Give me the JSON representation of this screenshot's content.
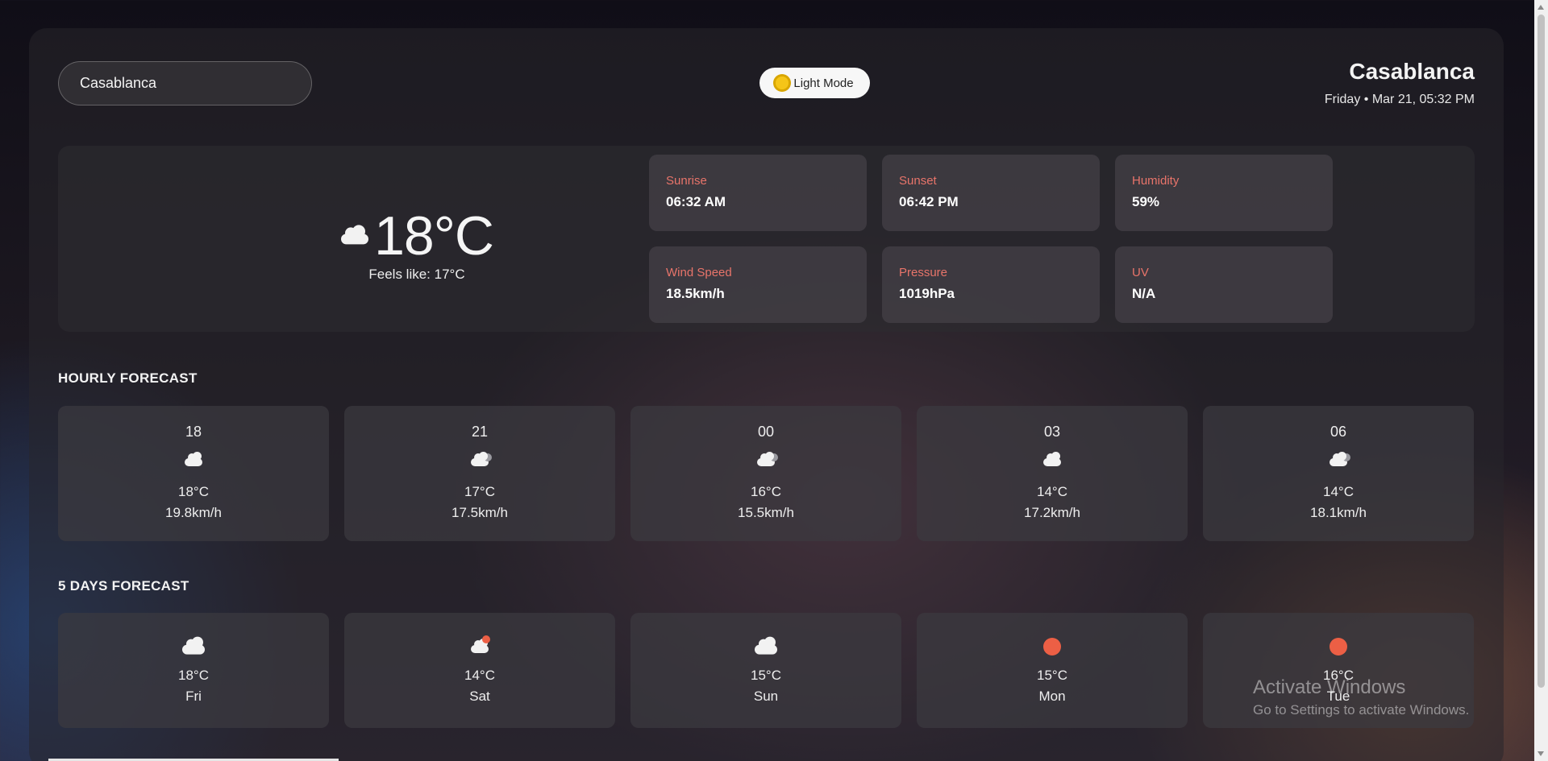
{
  "search": {
    "value": "Casablanca",
    "placeholder": ""
  },
  "theme_button": {
    "label": "Light Mode",
    "icon": "sun-icon"
  },
  "header": {
    "city": "Casablanca",
    "datetime": "Friday • Mar 21, 05:32 PM"
  },
  "current": {
    "icon": "cloud-icon",
    "temp": "18°C",
    "feels_like": "Feels like: 17°C",
    "stats": [
      {
        "label": "Sunrise",
        "value": "06:32 AM"
      },
      {
        "label": "Sunset",
        "value": "06:42 PM"
      },
      {
        "label": "Humidity",
        "value": "59%"
      },
      {
        "label": "Wind Speed",
        "value": "18.5km/h"
      },
      {
        "label": "Pressure",
        "value": "1019hPa"
      },
      {
        "label": "UV",
        "value": "N/A"
      }
    ]
  },
  "hourly": {
    "title": "HOURLY FORECAST",
    "items": [
      {
        "hour": "18",
        "icon": "cloud-icon",
        "temp": "18°C",
        "wind": "19.8km/h"
      },
      {
        "hour": "21",
        "icon": "cloud-icon",
        "temp": "17°C",
        "wind": "17.5km/h"
      },
      {
        "hour": "00",
        "icon": "cloud-icon",
        "temp": "16°C",
        "wind": "15.5km/h"
      },
      {
        "hour": "03",
        "icon": "cloud-icon",
        "temp": "14°C",
        "wind": "17.2km/h"
      },
      {
        "hour": "06",
        "icon": "cloud-icon",
        "temp": "14°C",
        "wind": "18.1km/h"
      }
    ]
  },
  "daily": {
    "title": "5 DAYS FORECAST",
    "items": [
      {
        "icon": "cloud-icon",
        "temp": "18°C",
        "day": "Fri"
      },
      {
        "icon": "partly-sunny-icon",
        "temp": "14°C",
        "day": "Sat"
      },
      {
        "icon": "cloud-icon",
        "temp": "15°C",
        "day": "Sun"
      },
      {
        "icon": "sun-icon",
        "temp": "15°C",
        "day": "Mon"
      },
      {
        "icon": "sun-icon",
        "temp": "16°C",
        "day": "Tue"
      }
    ]
  },
  "watermark": {
    "title": "Activate Windows",
    "subtitle": "Go to Settings to activate Windows."
  },
  "colors": {
    "stat_label": "#e8746a",
    "sun": "#ec5f45"
  }
}
